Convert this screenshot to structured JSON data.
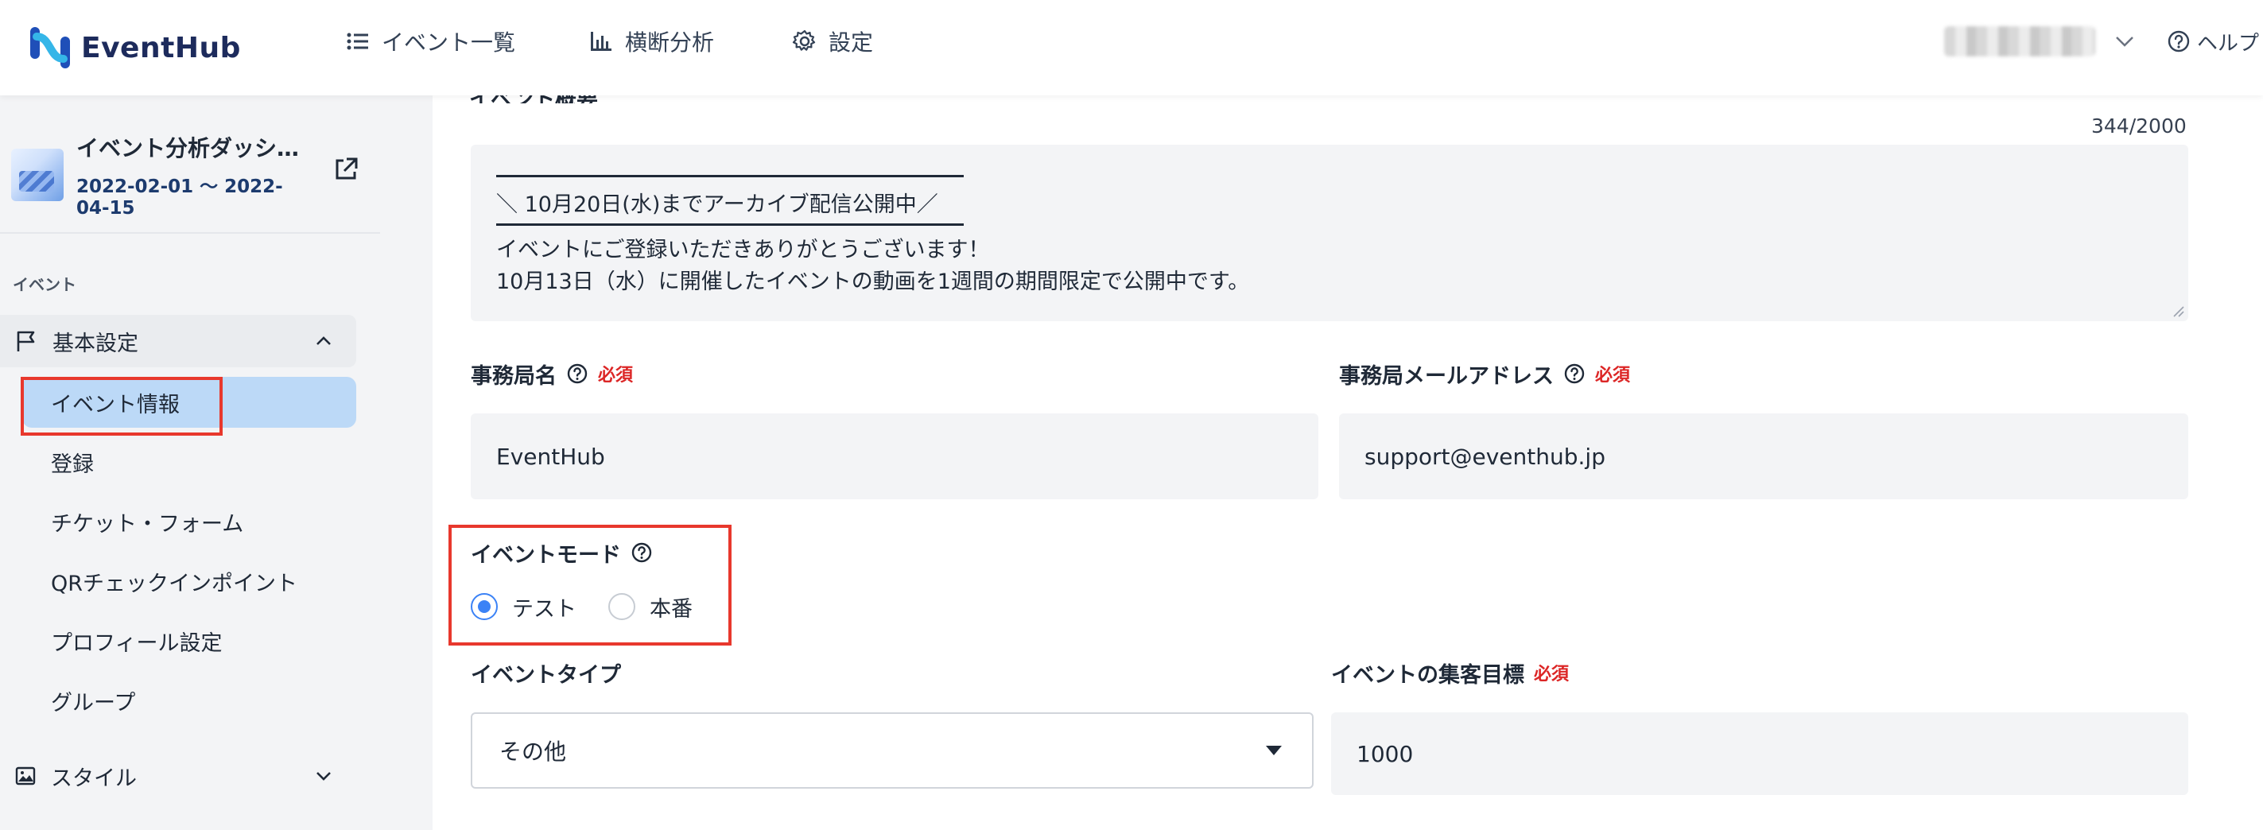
{
  "header": {
    "logo_text": "EventHub",
    "nav": [
      {
        "label": "イベント一覧",
        "icon": "list-icon"
      },
      {
        "label": "横断分析",
        "icon": "bar-chart-icon"
      },
      {
        "label": "設定",
        "icon": "gear-icon"
      }
    ],
    "help_label": "ヘルプ"
  },
  "sidebar": {
    "event_name": "イベント分析ダッシ…",
    "event_dates": "2022-02-01 〜 2022-04-15",
    "section_label": "イベント",
    "group_label": "基本設定",
    "items": [
      {
        "label": "イベント情報",
        "active": true
      },
      {
        "label": "登録"
      },
      {
        "label": "チケット・フォーム"
      },
      {
        "label": "QRチェックインポイント"
      },
      {
        "label": "プロフィール設定"
      },
      {
        "label": "グループ"
      }
    ],
    "style_label": "スタイル"
  },
  "main": {
    "overview_label": "イベント概要",
    "counter": "344/2000",
    "overview_lines": [
      "＼ 10月20日(水)までアーカイブ配信公開中／",
      "イベントにご登録いただきありがとうございます！",
      "10月13日（水）に開催したイベントの動画を1週間の期間限定で公開中です。"
    ],
    "office_name_label": "事務局名",
    "office_name_value": "EventHub",
    "office_email_label": "事務局メールアドレス",
    "office_email_value": "support@eventhub.jp",
    "required_label": "必須",
    "mode_label": "イベントモード",
    "mode_options": [
      {
        "label": "テスト",
        "checked": true
      },
      {
        "label": "本番",
        "checked": false
      }
    ],
    "type_label": "イベントタイプ",
    "type_value": "その他",
    "target_label": "イベントの集客目標",
    "target_value": "1000"
  },
  "colors": {
    "accent": "#3b82f6",
    "active_bg": "#bcd9f7",
    "highlight": "#e8382d",
    "required": "#dc2626"
  }
}
